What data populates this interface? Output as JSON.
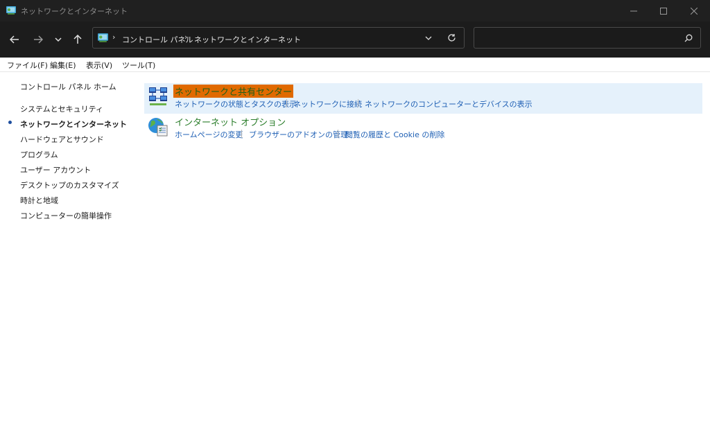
{
  "window": {
    "title": "ネットワークとインターネット"
  },
  "nav": {
    "breadcrumb": [
      "コントロール パネル",
      "ネットワークとインターネット"
    ],
    "search_placeholder": ""
  },
  "menu": [
    "ファイル(F)",
    "編集(E)",
    "表示(V)",
    "ツール(T)"
  ],
  "sidebar": {
    "home": "コントロール パネル ホーム",
    "items": [
      {
        "label": "システムとセキュリティ",
        "current": false
      },
      {
        "label": "ネットワークとインターネット",
        "current": true
      },
      {
        "label": "ハードウェアとサウンド",
        "current": false
      },
      {
        "label": "プログラム",
        "current": false
      },
      {
        "label": "ユーザー アカウント",
        "current": false
      },
      {
        "label": "デスクトップのカスタマイズ",
        "current": false
      },
      {
        "label": "時計と地域",
        "current": false
      },
      {
        "label": "コンピューターの簡単操作",
        "current": false
      }
    ]
  },
  "categories": [
    {
      "title": "ネットワークと共有センター",
      "links": [
        "ネットワークの状態とタスクの表示",
        "ネットワークに接続",
        "ネットワークのコンピューターとデバイスの表示"
      ],
      "icon": "network-sharing-center-icon"
    },
    {
      "title": "インターネット オプション",
      "links": [
        "ホームページの変更",
        "ブラウザーのアドオンの管理",
        "閲覧の履歴と Cookie の削除"
      ],
      "icon": "internet-options-icon"
    }
  ],
  "colors": {
    "link": "#1e5fb4",
    "category_title": "#2a7d2a",
    "highlight_row": "#e5f1fb",
    "title_highlight": "#e06a00"
  }
}
